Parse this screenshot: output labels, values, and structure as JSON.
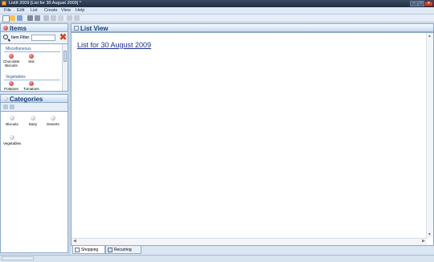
{
  "window": {
    "title": "ListIt 2009 [List for 30 August 2009] *"
  },
  "menu": [
    "File",
    "Edit",
    "List",
    "Create",
    "View",
    "Help"
  ],
  "items_panel": {
    "title": "Items",
    "filter_label": "Item Filter",
    "filter_value": "",
    "groups": [
      {
        "label": "Miscellaneous",
        "items": [
          "Chocolate Biscuits",
          "test"
        ]
      },
      {
        "label": "Vegetables",
        "items": [
          "Potatoes",
          "Tomatoes"
        ]
      }
    ]
  },
  "categories_panel": {
    "title": "Categories",
    "items": [
      "Biscuits",
      "Dairy",
      "Deserts",
      "Vegetables"
    ]
  },
  "list_view": {
    "title": "List View",
    "list_title": "List for 30 August 2009"
  },
  "tabs": [
    {
      "label": "Shopping List",
      "active": true
    },
    {
      "label": "Recurring Lists",
      "active": false
    }
  ],
  "colors": {
    "accent": "#1b3f78",
    "link": "#1d2f8a",
    "clear_icon": "#d2461b"
  }
}
